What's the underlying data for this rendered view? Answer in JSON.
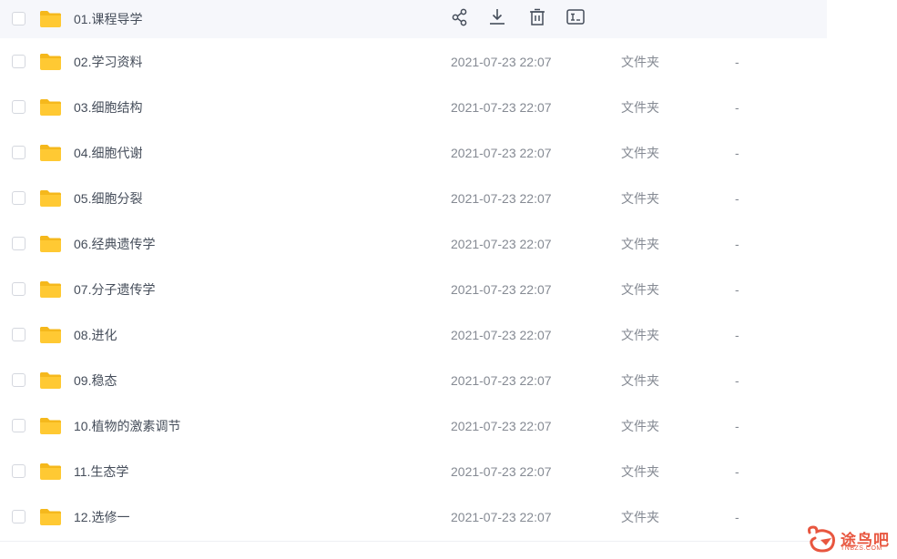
{
  "file_list": {
    "rows": [
      {
        "name": "01.课程导学",
        "date": "",
        "type": "",
        "size": ""
      },
      {
        "name": "02.学习资料",
        "date": "2021-07-23 22:07",
        "type": "文件夹",
        "size": "-"
      },
      {
        "name": "03.细胞结构",
        "date": "2021-07-23 22:07",
        "type": "文件夹",
        "size": "-"
      },
      {
        "name": "04.细胞代谢",
        "date": "2021-07-23 22:07",
        "type": "文件夹",
        "size": "-"
      },
      {
        "name": "05.细胞分裂",
        "date": "2021-07-23 22:07",
        "type": "文件夹",
        "size": "-"
      },
      {
        "name": "06.经典遗传学",
        "date": "2021-07-23 22:07",
        "type": "文件夹",
        "size": "-"
      },
      {
        "name": "07.分子遗传学",
        "date": "2021-07-23 22:07",
        "type": "文件夹",
        "size": "-"
      },
      {
        "name": "08.进化",
        "date": "2021-07-23 22:07",
        "type": "文件夹",
        "size": "-"
      },
      {
        "name": "09.稳态",
        "date": "2021-07-23 22:07",
        "type": "文件夹",
        "size": "-"
      },
      {
        "name": "10.植物的激素调节",
        "date": "2021-07-23 22:07",
        "type": "文件夹",
        "size": "-"
      },
      {
        "name": "11.生态学",
        "date": "2021-07-23 22:07",
        "type": "文件夹",
        "size": "-"
      },
      {
        "name": "12.选修一",
        "date": "2021-07-23 22:07",
        "type": "文件夹",
        "size": "-"
      }
    ],
    "hover_actions": [
      {
        "icon": "share-icon"
      },
      {
        "icon": "download-icon"
      },
      {
        "icon": "delete-icon"
      },
      {
        "icon": "rename-icon"
      }
    ]
  },
  "watermark": {
    "cn": "途鸟吧",
    "en": "TNBZS.COM"
  },
  "colors": {
    "folder": "#ffc933",
    "folder_tab": "#f5b81c",
    "hover_row": "#f6f7fb",
    "text_primary": "#454d5a",
    "text_secondary": "#858a93",
    "watermark": "#e8563f"
  }
}
